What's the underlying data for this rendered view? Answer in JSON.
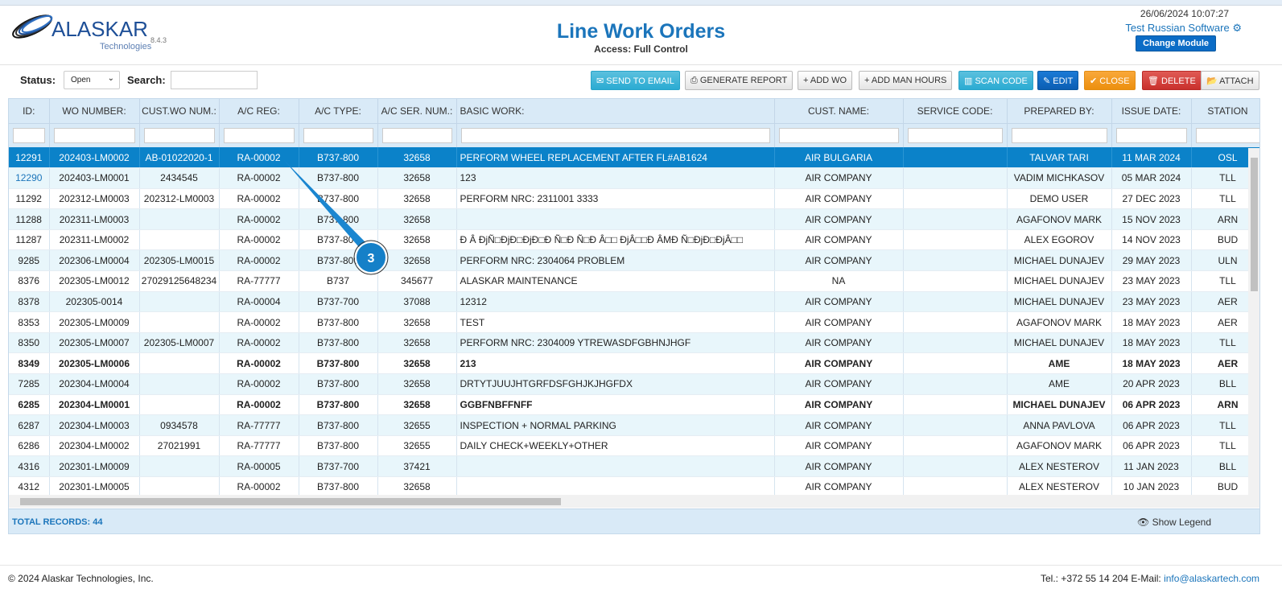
{
  "header": {
    "logo_text": "ALASKAR",
    "logo_sub": "Technologies",
    "version": "8.4.3",
    "title": "Line Work Orders",
    "access": "Access: Full Control",
    "datetime": "26/06/2024 10:07:27",
    "software": "Test Russian Software",
    "change_module": "Change Module"
  },
  "toolbar": {
    "status_label": "Status:",
    "status_value": "Open",
    "search_label": "Search:",
    "search_value": "",
    "buttons": [
      {
        "label": "SEND TO EMAIL",
        "icon": "✉"
      },
      {
        "label": "GENERATE REPORT",
        "icon": "⎙"
      },
      {
        "label": "ADD WO",
        "icon": "+"
      },
      {
        "label": "ADD MAN HOURS",
        "icon": "+"
      },
      {
        "label": "SCAN CODE",
        "icon": "▥"
      },
      {
        "label": "EDIT",
        "icon": "✎"
      },
      {
        "label": "CLOSE",
        "icon": "✔"
      },
      {
        "label": "DELETE",
        "icon": "🗑"
      },
      {
        "label": "ATTACH",
        "icon": "📂"
      }
    ]
  },
  "table": {
    "columns": [
      "ID:",
      "WO NUMBER:",
      "CUST.WO NUM.:",
      "A/C REG:",
      "A/C TYPE:",
      "A/C SER. NUM.:",
      "BASIC WORK:",
      "CUST. NAME:",
      "SERVICE CODE:",
      "PREPARED BY:",
      "ISSUE DATE:",
      "STATION"
    ],
    "rows": [
      [
        "12291",
        "202403-LM0002",
        "AB-01022020-1",
        "RA-00002",
        "B737-800",
        "32658",
        "PERFORM WHEEL REPLACEMENT AFTER FL#AB1624",
        "AIR BULGARIA",
        "",
        "TALVAR TARI",
        "11 MAR 2024",
        "OSL"
      ],
      [
        "12290",
        "202403-LM0001",
        "2434545",
        "RA-00002",
        "B737-800",
        "32658",
        "123",
        "AIR COMPANY",
        "",
        "VADIM MICHKASOV",
        "05 MAR 2024",
        "TLL"
      ],
      [
        "11292",
        "202312-LM0003",
        "202312-LM0003",
        "RA-00002",
        "B737-800",
        "32658",
        "PERFORM NRC: 2311001 3333",
        "AIR COMPANY",
        "",
        "DEMO USER",
        "27 DEC 2023",
        "TLL"
      ],
      [
        "11288",
        "202311-LM0003",
        "",
        "RA-00002",
        "B737-800",
        "32658",
        "",
        "AIR COMPANY",
        "",
        "AGAFONOV MARK",
        "15 NOV 2023",
        "ARN"
      ],
      [
        "11287",
        "202311-LM0002",
        "",
        "RA-00002",
        "B737-800",
        "32658",
        "Ð Â ÐjÑ□ÐjÐ□ÐjÐ□Ð Ñ□Ð Ñ□Ð Â□□ ÐjÂ□□Ð ÂMÐ Ñ□ÐjÐ□ÐjÂ□□",
        "AIR COMPANY",
        "",
        "ALEX EGOROV",
        "14 NOV 2023",
        "BUD"
      ],
      [
        "9285",
        "202306-LM0004",
        "202305-LM0015",
        "RA-00002",
        "B737-800",
        "32658",
        "PERFORM NRC: 2304064 PROBLEM",
        "AIR COMPANY",
        "",
        "MICHAEL DUNAJEV",
        "29 MAY 2023",
        "ULN"
      ],
      [
        "8376",
        "202305-LM0012",
        "27029125648234",
        "RA-77777",
        "B737",
        "345677",
        "ALASKAR MAINTENANCE",
        "NA",
        "",
        "MICHAEL DUNAJEV",
        "23 MAY 2023",
        "TLL"
      ],
      [
        "8378",
        "202305-0014",
        "",
        "RA-00004",
        "B737-700",
        "37088",
        "12312",
        "AIR COMPANY",
        "",
        "MICHAEL DUNAJEV",
        "23 MAY 2023",
        "AER"
      ],
      [
        "8353",
        "202305-LM0009",
        "",
        "RA-00002",
        "B737-800",
        "32658",
        "TEST",
        "AIR COMPANY",
        "",
        "AGAFONOV MARK",
        "18 MAY 2023",
        "AER"
      ],
      [
        "8350",
        "202305-LM0007",
        "202305-LM0007",
        "RA-00002",
        "B737-800",
        "32658",
        "PERFORM NRC: 2304009 YTREWASDFGBHNJHGF",
        "AIR COMPANY",
        "",
        "MICHAEL DUNAJEV",
        "18 MAY 2023",
        "TLL"
      ],
      [
        "8349",
        "202305-LM0006",
        "",
        "RA-00002",
        "B737-800",
        "32658",
        "213",
        "AIR COMPANY",
        "",
        "AME",
        "18 MAY 2023",
        "AER"
      ],
      [
        "7285",
        "202304-LM0004",
        "",
        "RA-00002",
        "B737-800",
        "32658",
        "DRTYTJUUJHTGRFDSFGHJKJHGFDX",
        "AIR COMPANY",
        "",
        "AME",
        "20 APR 2023",
        "BLL"
      ],
      [
        "6285",
        "202304-LM0001",
        "",
        "RA-00002",
        "B737-800",
        "32658",
        "GGBFNBFFNFF",
        "AIR COMPANY",
        "",
        "MICHAEL DUNAJEV",
        "06 APR 2023",
        "ARN"
      ],
      [
        "6287",
        "202304-LM0003",
        "0934578",
        "RA-77777",
        "B737-800",
        "32655",
        "INSPECTION + NORMAL PARKING",
        "AIR COMPANY",
        "",
        "ANNA PAVLOVA",
        "06 APR 2023",
        "TLL"
      ],
      [
        "6286",
        "202304-LM0002",
        "27021991",
        "RA-77777",
        "B737-800",
        "32655",
        "DAILY CHECK+WEEKLY+OTHER",
        "AIR COMPANY",
        "",
        "AGAFONOV MARK",
        "06 APR 2023",
        "TLL"
      ],
      [
        "4316",
        "202301-LM0009",
        "",
        "RA-00005",
        "B737-700",
        "37421",
        "",
        "AIR COMPANY",
        "",
        "ALEX NESTEROV",
        "11 JAN 2023",
        "BLL"
      ],
      [
        "4312",
        "202301-LM0005",
        "",
        "RA-00002",
        "B737-800",
        "32658",
        "",
        "AIR COMPANY",
        "",
        "ALEX NESTEROV",
        "10 JAN 2023",
        "BUD"
      ]
    ],
    "selected_row": 0,
    "bold_rows": [
      10,
      12
    ],
    "total_records": "TOTAL RECORDS: 44",
    "show_legend": "Show Legend"
  },
  "callout": {
    "number": "3"
  },
  "footer": {
    "copyright": "© 2024 Alaskar Technologies, Inc.",
    "contact": "Tel.: +372 55 14 204 E-Mail:",
    "email": "info@alaskartech.com"
  },
  "colors": {
    "accent": "#1b75bb",
    "selected_row": "#0b82c9",
    "header_bg": "#d9eaf7"
  }
}
